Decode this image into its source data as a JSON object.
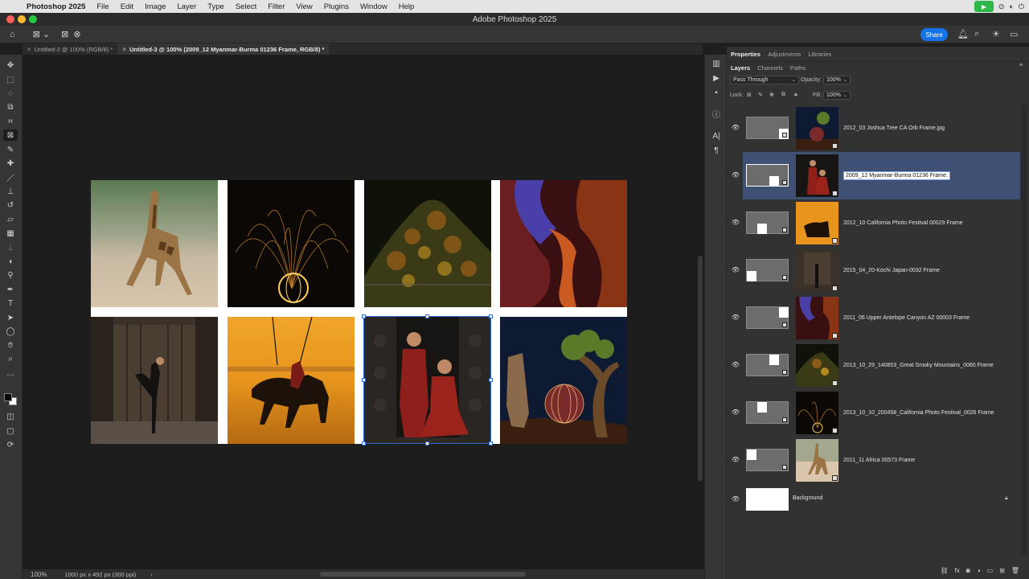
{
  "menubar": {
    "apple": "",
    "app_name": "Photoshop 2025",
    "items": [
      "File",
      "Edit",
      "Image",
      "Layer",
      "Type",
      "Select",
      "Filter",
      "View",
      "Plugins",
      "Window",
      "Help"
    ]
  },
  "window": {
    "title": "Adobe Photoshop 2025"
  },
  "options_bar": {
    "share_label": "Share"
  },
  "tabs": [
    {
      "label": "Untitled-2 @ 100% (RGB/8) *",
      "active": false
    },
    {
      "label": "Untitled-3 @ 100% (2009_12 Myanmar-Burma 01236 Frame, RGB/8) *",
      "active": true
    }
  ],
  "status": {
    "zoom": "100%",
    "doc_info": "1000 px x 492 px (300 ppi)",
    "arrow": "›"
  },
  "panel": {
    "top_tabs": [
      "Properties",
      "Adjustments",
      "Libraries"
    ],
    "layer_tabs": [
      "Layers",
      "Channels",
      "Paths"
    ],
    "blend_mode": "Pass Through",
    "opacity_label": "Opacity:",
    "opacity_value": "100%",
    "lock_label": "Lock:",
    "fill_label": "Fill:",
    "fill_value": "100%"
  },
  "layers": [
    {
      "name": "2012_03 Joshua Tree CA Orb Frame.jpg",
      "selected": false
    },
    {
      "name": "2009_12 Myanmar-Burma 01236 Frame.",
      "selected": true
    },
    {
      "name": "2012_10 California Photo Festival 00029 Frame",
      "selected": false
    },
    {
      "name": "2015_04_20-Kochi Japan-0032 Frame",
      "selected": false
    },
    {
      "name": "2011_06 Upper Antelope Canyon AZ 00003 Frame",
      "selected": false
    },
    {
      "name": "2013_10_29_140853_Great Smoky Mountains_0060 Frame",
      "selected": false
    },
    {
      "name": "2013_10_10_200458_California Photo Festival_0026 Frame",
      "selected": false
    },
    {
      "name": "2011_11 Africa 00573 Frame",
      "selected": false
    },
    {
      "name": "Background",
      "selected": false
    }
  ],
  "colors": {
    "accent": "#1473e6",
    "selection": "#3e5074",
    "frame_border": "#2e6bd6"
  }
}
